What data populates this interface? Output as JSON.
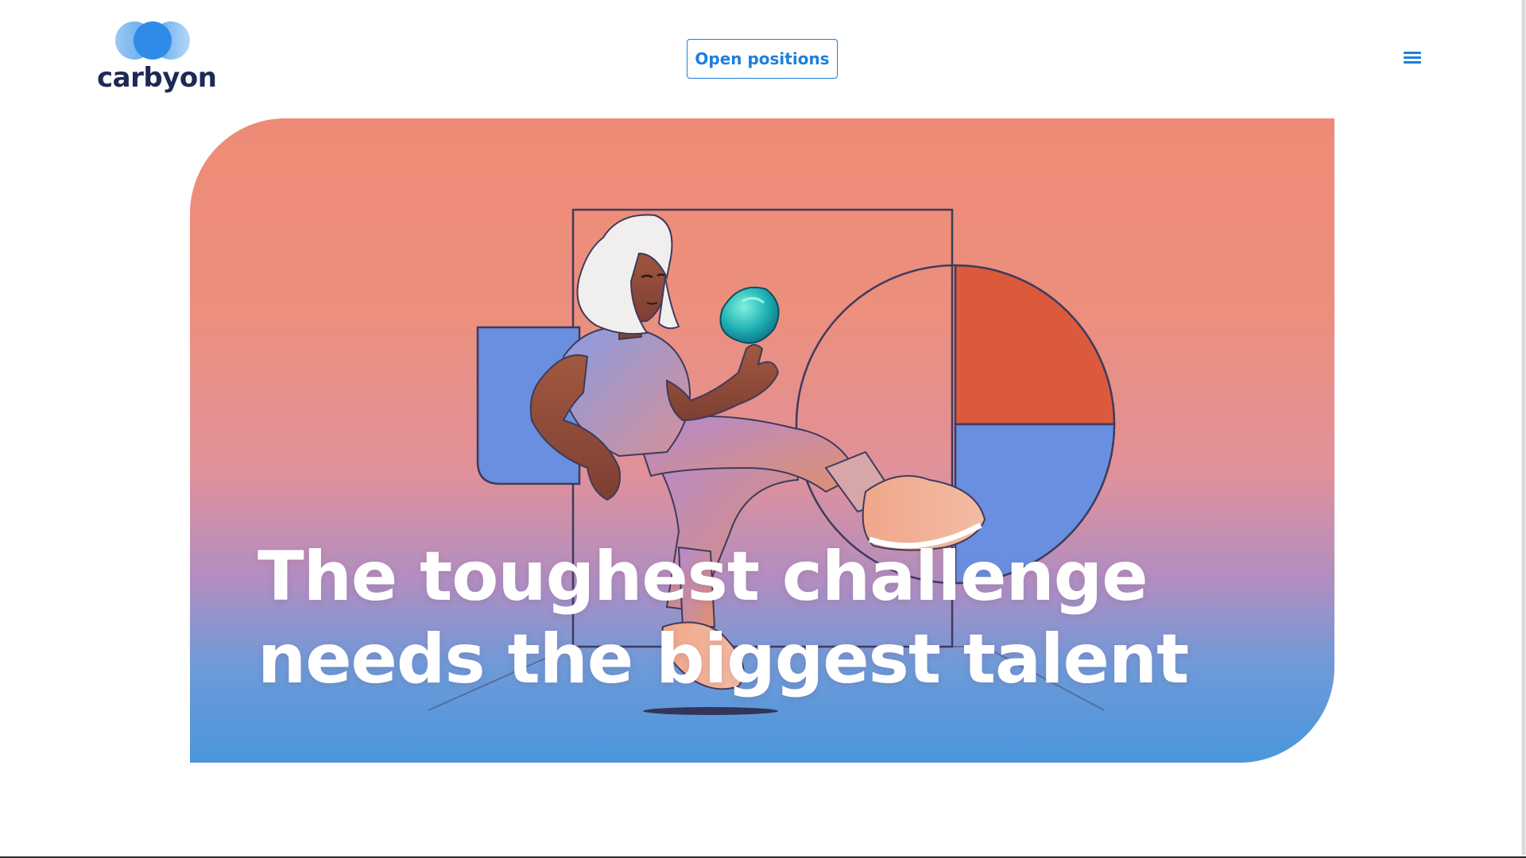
{
  "brand": {
    "name": "carbyon",
    "logo_icon": "overlapping-circles-logo",
    "colors": {
      "primary": "#1b7fe0",
      "text_dark": "#1d2a55",
      "logo_dark_blue": "#2f8be8",
      "logo_light_blue": "#9cc7f4"
    }
  },
  "header": {
    "cta_label": "Open positions",
    "menu_icon": "hamburger-menu-icon"
  },
  "hero": {
    "headline_line1": "The toughest challenge",
    "headline_line2": "needs the biggest talent",
    "illustration_icon": "woman-sitting-with-orb-illustration",
    "colors": {
      "gradient_top": "#ee8b76",
      "gradient_bottom": "#4a97dc",
      "accent_orange": "#dc5a3c",
      "accent_blue": "#6a8fe0",
      "orb_teal": "#1fb0b2"
    }
  }
}
